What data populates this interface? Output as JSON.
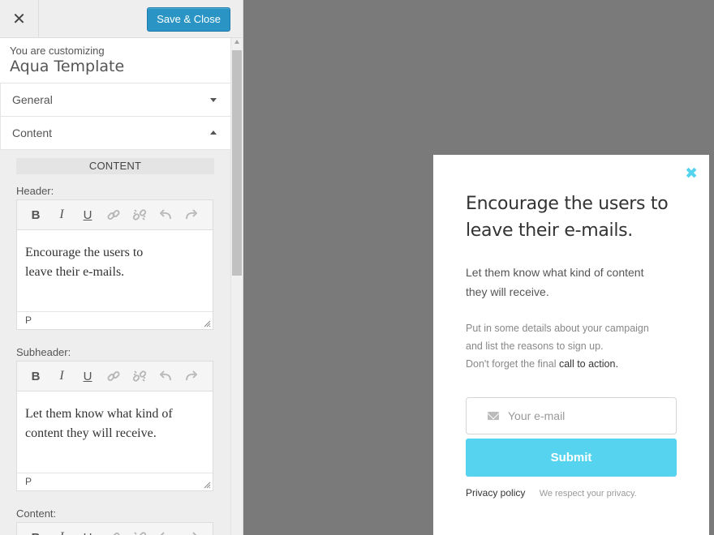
{
  "panel": {
    "close_glyph": "✕",
    "save_label": "Save & Close",
    "customizing_label": "You are customizing",
    "template_name": "Aqua Template",
    "sections": [
      {
        "label": "General",
        "state": "collapsed"
      },
      {
        "label": "Content",
        "state": "expanded"
      }
    ],
    "content_title": "CONTENT",
    "fields": [
      {
        "label": "Header:",
        "text_line1": "Encourage the users to",
        "text_line2": "leave their e-mails.",
        "status": "P"
      },
      {
        "label": "Subheader:",
        "text_line1": "Let them know what kind of",
        "text_line2": "content they will receive.",
        "status": "P"
      },
      {
        "label": "Content:"
      }
    ],
    "toolbar_icons": [
      "bold-icon",
      "italic-icon",
      "underline-icon",
      "link-icon",
      "unlink-icon",
      "undo-icon",
      "redo-icon"
    ],
    "toolbar_glyphs": {
      "bold": "B",
      "italic": "I",
      "underline": "U"
    }
  },
  "popup": {
    "close_glyph": "✖",
    "header_line1": "Encourage the users to",
    "header_line2": "leave their e-mails.",
    "sub_line1": "Let them know what kind of content",
    "sub_line2": "they will receive.",
    "content_line1": "Put in some details about your campaign",
    "content_line2": "and list the reasons to sign up.",
    "content_line3_prefix": "Don't forget the final ",
    "content_cta": "call to action.",
    "email_placeholder": "Your e-mail",
    "submit_label": "Submit",
    "privacy_label": "Privacy policy",
    "respect_label": "We respect your privacy."
  },
  "colors": {
    "accent": "#56d3ee",
    "save_button": "#2a95c5",
    "backdrop": "#7a7a7a"
  }
}
